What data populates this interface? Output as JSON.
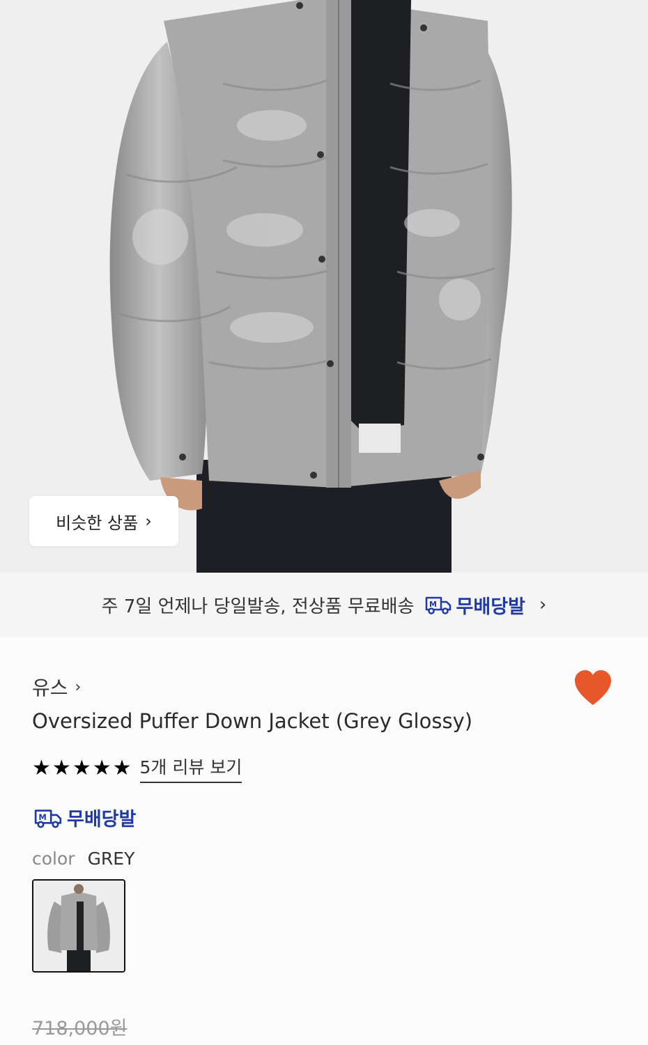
{
  "hero": {
    "similar_button_label": "비슷한 상품",
    "chevron": "›"
  },
  "shipping_banner": {
    "text": "주 7일 언제나 당일발송, 전상품 무료배송",
    "badge_label": "무배당발",
    "chevron": "›"
  },
  "product": {
    "brand": "유스",
    "brand_chevron": "›",
    "title": "Oversized Puffer Down Jacket (Grey Glossy)",
    "rating_stars": 5,
    "review_link": "5개 리뷰 보기",
    "badge_label": "무배당발",
    "color_label": "color",
    "color_value": "GREY",
    "original_price": "718,000원",
    "wishlisted": true
  },
  "colors": {
    "badge_blue": "#1f3aa5",
    "heart": "#e8572a"
  }
}
